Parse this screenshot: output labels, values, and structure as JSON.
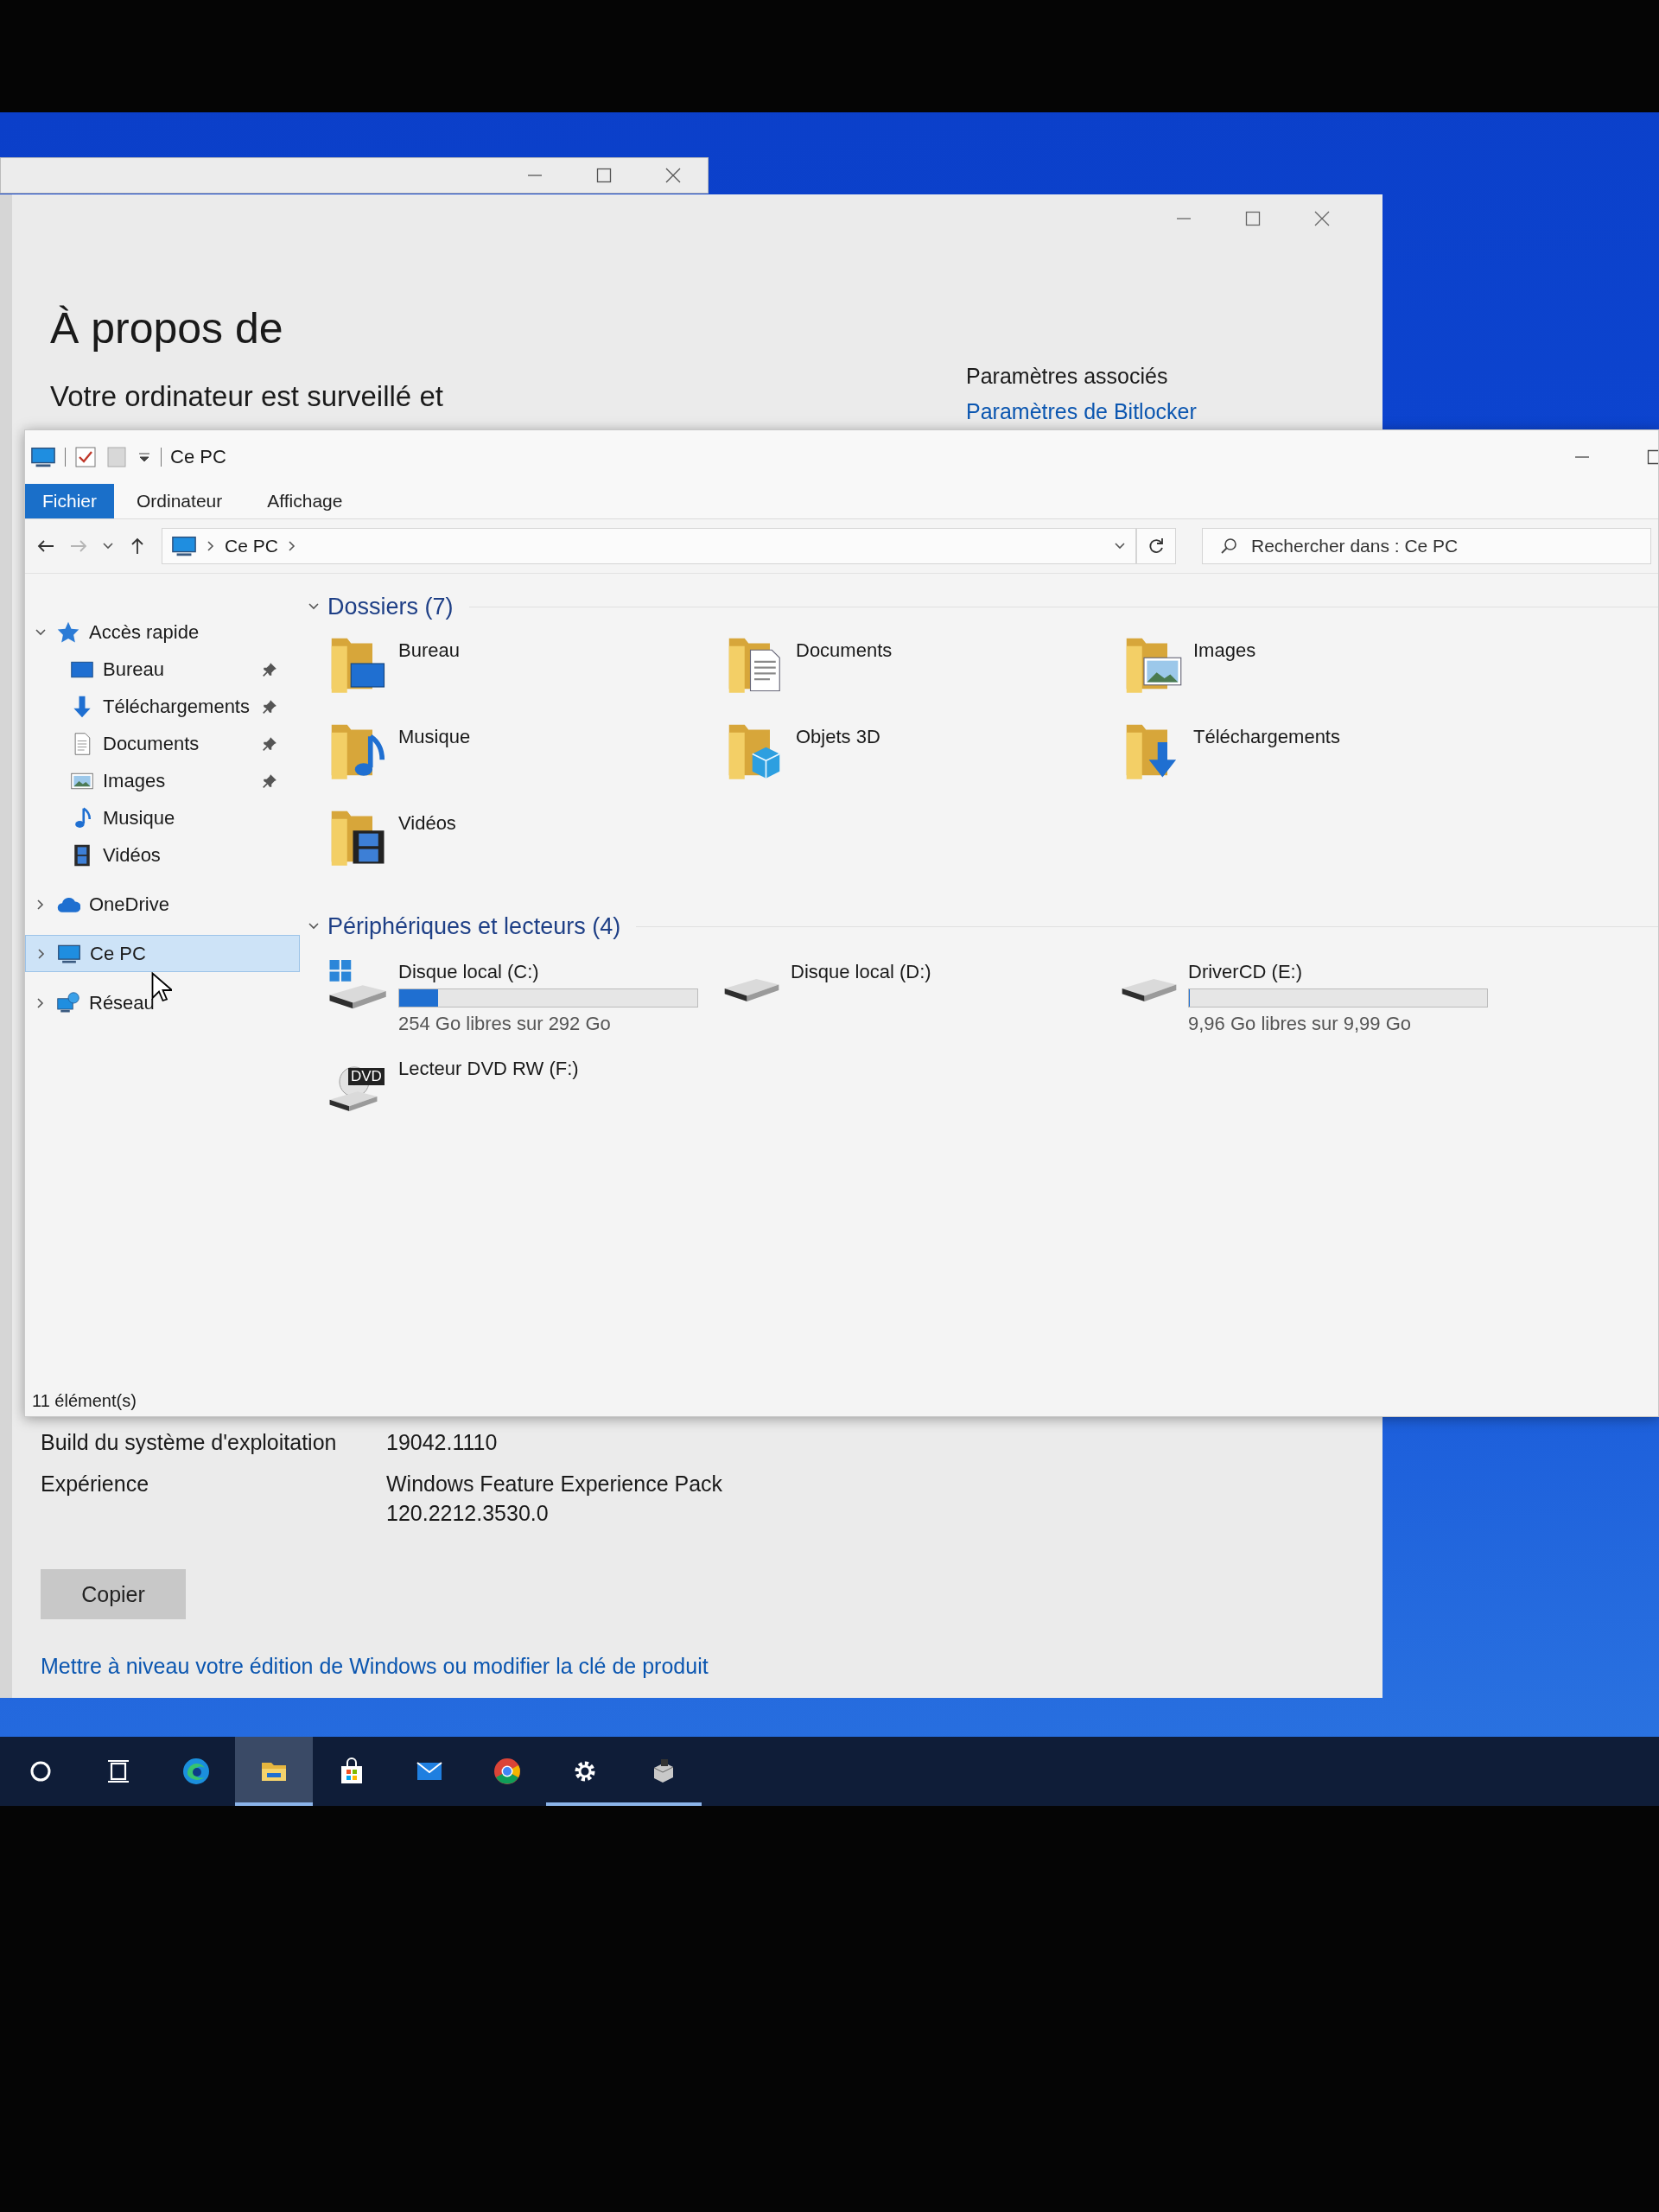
{
  "settings_window": {
    "title": "À propos de",
    "status_text": "Votre ordinateur est surveillé et",
    "related": {
      "heading": "Paramètres associés",
      "links": [
        "Paramètres de Bitlocker"
      ]
    },
    "specs": [
      {
        "label": "Build du système d'exploitation",
        "value_lines": [
          "19042.1110"
        ]
      },
      {
        "label": "Expérience",
        "value_lines": [
          "Windows Feature Experience Pack",
          "120.2212.3530.0"
        ]
      }
    ],
    "copy_button": "Copier",
    "upgrade_link": "Mettre à niveau votre édition de Windows ou modifier la clé de produit"
  },
  "explorer": {
    "title": "Ce PC",
    "ribbon_tabs": [
      {
        "label": "Fichier",
        "kind": "file"
      },
      {
        "label": "Ordinateur",
        "kind": "tab"
      },
      {
        "label": "Affichage",
        "kind": "tab"
      }
    ],
    "address": {
      "path": [
        "Ce PC"
      ]
    },
    "search": {
      "placeholder": "Rechercher dans : Ce PC"
    },
    "nav": [
      {
        "label": "Accès rapide",
        "expanded": true,
        "selected": false,
        "children": [
          {
            "label": "Bureau",
            "pinned": true,
            "selected": false
          },
          {
            "label": "Téléchargements",
            "pinned": true,
            "selected": false
          },
          {
            "label": "Documents",
            "pinned": true,
            "selected": false
          },
          {
            "label": "Images",
            "pinned": true,
            "selected": false
          },
          {
            "label": "Musique",
            "pinned": false,
            "selected": false
          },
          {
            "label": "Vidéos",
            "pinned": false,
            "selected": false
          }
        ]
      },
      {
        "label": "OneDrive",
        "expanded": false,
        "selected": false
      },
      {
        "label": "Ce PC",
        "expanded": false,
        "selected": true
      },
      {
        "label": "Réseau",
        "expanded": false,
        "selected": false
      }
    ],
    "groups": [
      {
        "title": "Dossiers (7)",
        "expanded": true,
        "items": [
          {
            "kind": "folder",
            "name": "Bureau"
          },
          {
            "kind": "folder",
            "name": "Documents"
          },
          {
            "kind": "folder",
            "name": "Images"
          },
          {
            "kind": "folder",
            "name": "Musique"
          },
          {
            "kind": "folder",
            "name": "Objets 3D"
          },
          {
            "kind": "folder",
            "name": "Téléchargements"
          },
          {
            "kind": "folder",
            "name": "Vidéos"
          }
        ]
      },
      {
        "title": "Périphériques et lecteurs (4)",
        "expanded": true,
        "items": [
          {
            "kind": "drive",
            "name": "Disque local (C:)",
            "level": 0.13,
            "free": "254 Go libres sur 292 Go"
          },
          {
            "kind": "drive",
            "name": "Disque local (D:)"
          },
          {
            "kind": "drive",
            "name": "DriverCD (E:)",
            "level": 0.003,
            "free": "9,96 Go libres sur 9,99 Go"
          },
          {
            "kind": "dvd",
            "name": "Lecteur DVD RW (F:)",
            "badge": "DVD"
          }
        ]
      }
    ],
    "status": "11 élément(s)"
  },
  "taskbar": [
    {
      "active": false,
      "running": false
    },
    {
      "active": false,
      "running": false
    },
    {
      "active": false,
      "running": false
    },
    {
      "active": true,
      "running": true
    },
    {
      "active": false,
      "running": false
    },
    {
      "active": false,
      "running": false
    },
    {
      "active": false,
      "running": false
    },
    {
      "active": false,
      "running": true
    },
    {
      "active": false,
      "running": true
    }
  ]
}
